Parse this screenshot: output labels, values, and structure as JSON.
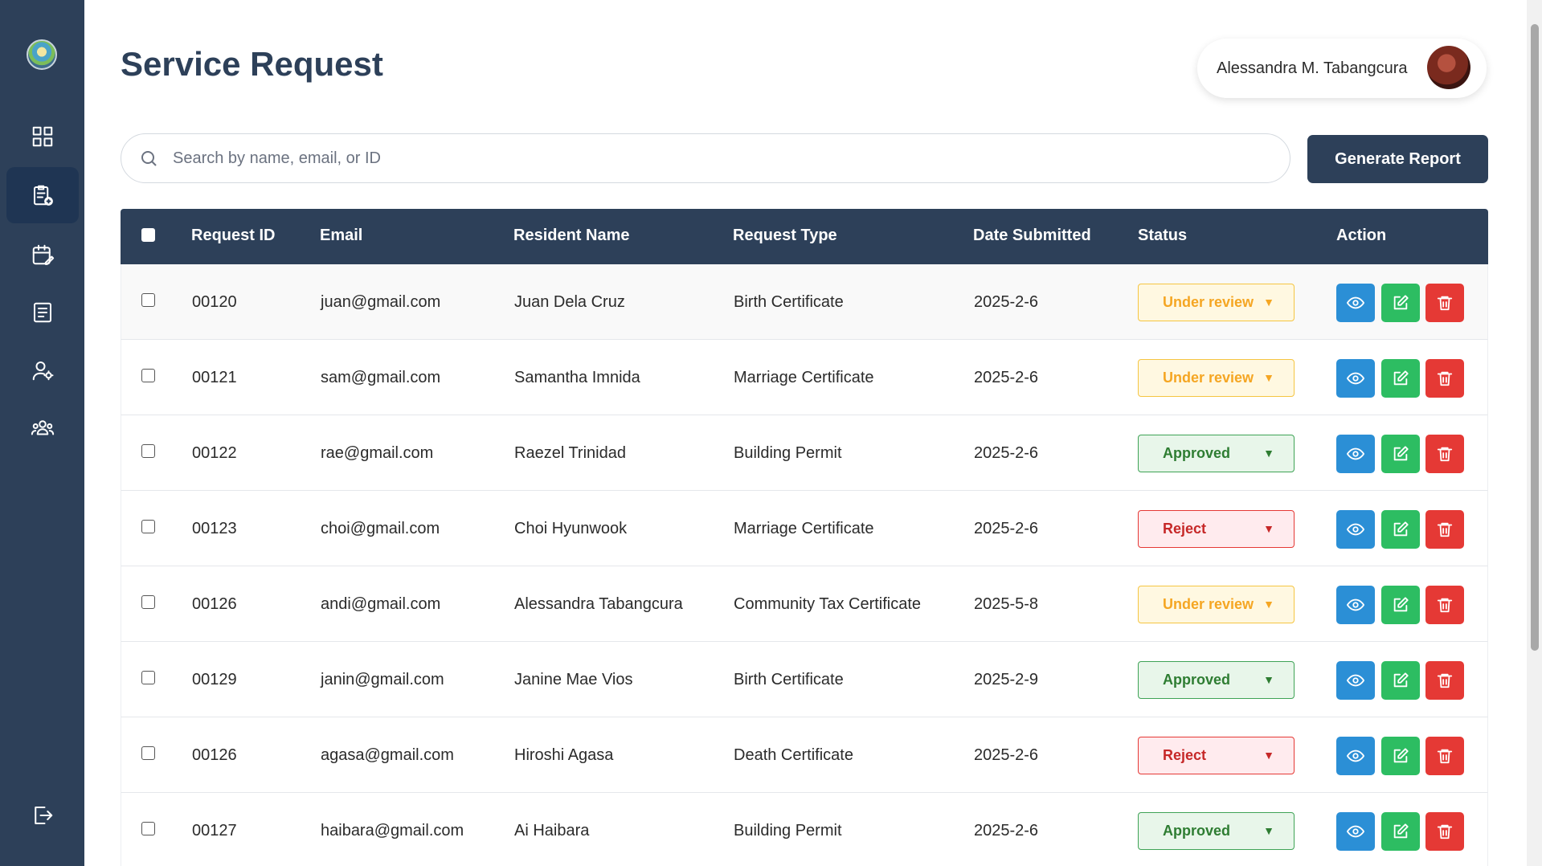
{
  "page": {
    "title": "Service Request"
  },
  "user": {
    "name": "Alessandra M. Tabangcura"
  },
  "search": {
    "placeholder": "Search by name, email, or ID"
  },
  "actions": {
    "generate_report": "Generate Report"
  },
  "sidebar": {
    "items": [
      {
        "icon": "dashboard-icon",
        "active": false
      },
      {
        "icon": "service-request-icon",
        "active": true
      },
      {
        "icon": "calendar-edit-icon",
        "active": false
      },
      {
        "icon": "document-list-icon",
        "active": false
      },
      {
        "icon": "user-settings-icon",
        "active": false
      },
      {
        "icon": "residents-group-icon",
        "active": false
      }
    ],
    "logout_icon": "logout-icon"
  },
  "table": {
    "headers": {
      "request_id": "Request ID",
      "email": "Email",
      "resident_name": "Resident Name",
      "request_type": "Request Type",
      "date_submitted": "Date Submitted",
      "status": "Status",
      "action": "Action"
    },
    "rows": [
      {
        "id": "00120",
        "email": "juan@gmail.com",
        "name": "Juan Dela Cruz",
        "type": "Birth Certificate",
        "date": "2025-2-6",
        "status": "Under review"
      },
      {
        "id": "00121",
        "email": "sam@gmail.com",
        "name": "Samantha Imnida",
        "type": "Marriage Certificate",
        "date": "2025-2-6",
        "status": "Under review"
      },
      {
        "id": "00122",
        "email": "rae@gmail.com",
        "name": "Raezel Trinidad",
        "type": "Building Permit",
        "date": "2025-2-6",
        "status": "Approved"
      },
      {
        "id": "00123",
        "email": "choi@gmail.com",
        "name": "Choi Hyunwook",
        "type": "Marriage Certificate",
        "date": "2025-2-6",
        "status": "Reject"
      },
      {
        "id": "00126",
        "email": "andi@gmail.com",
        "name": "Alessandra Tabangcura",
        "type": "Community Tax Certificate",
        "date": "2025-5-8",
        "status": "Under review"
      },
      {
        "id": "00129",
        "email": "janin@gmail.com",
        "name": "Janine Mae Vios",
        "type": "Birth Certificate",
        "date": "2025-2-9",
        "status": "Approved"
      },
      {
        "id": "00126",
        "email": "agasa@gmail.com",
        "name": "Hiroshi Agasa",
        "type": "Death Certificate",
        "date": "2025-2-6",
        "status": "Reject"
      },
      {
        "id": "00127",
        "email": "haibara@gmail.com",
        "name": "Ai Haibara",
        "type": "Building Permit",
        "date": "2025-2-6",
        "status": "Approved"
      }
    ]
  },
  "colors": {
    "sidebar": "#2d4059",
    "view": "#2b8fd6",
    "edit": "#2dbd62",
    "delete": "#e53935",
    "under_review": "#f5a623",
    "approved": "#2e7d32",
    "reject": "#c62828"
  }
}
